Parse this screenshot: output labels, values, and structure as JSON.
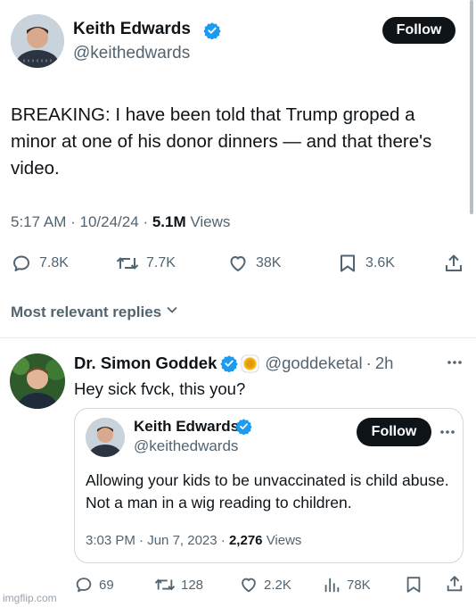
{
  "main_tweet": {
    "author_name": "Keith Edwards",
    "handle": "@keithedwards",
    "follow_label": "Follow",
    "text": "BREAKING: I have been told that Trump groped a minor at one of his donor dinners — and that there's video.",
    "time": "5:17 AM",
    "date": "10/24/24",
    "views_count": "5.1M",
    "views_label": "Views",
    "stats": {
      "replies": "7.8K",
      "reposts": "7.7K",
      "likes": "38K",
      "bookmarks": "3.6K"
    }
  },
  "replies_sort": {
    "label": "Most relevant replies"
  },
  "reply": {
    "author_name": "Dr. Simon Goddek",
    "handle": "@goddeketal",
    "age": "2h",
    "text": "Hey sick fvck, this you?",
    "stats": {
      "replies": "69",
      "reposts": "128",
      "likes": "2.2K",
      "views": "78K"
    }
  },
  "quoted_tweet": {
    "author_name": "Keith Edwards",
    "handle": "@keithedwards",
    "follow_label": "Follow",
    "text": "Allowing your kids to be unvaccinated is child abuse. Not a man in a wig reading to children.",
    "time": "3:03 PM",
    "date": "Jun 7, 2023",
    "views_count": "2,276",
    "views_label": "Views"
  },
  "watermark": "imgflip.com",
  "colors": {
    "verified_blue": "#1d9bf0",
    "text_primary": "#0f1419",
    "text_secondary": "#536471",
    "button_dark": "#0f1419",
    "divider": "#e6ecf0"
  },
  "icons": [
    "verified-badge-icon",
    "reply-icon",
    "repost-icon",
    "like-icon",
    "bookmark-icon",
    "share-icon",
    "views-icon",
    "chevron-down-icon",
    "more-icon",
    "gold-affiliate-badge-icon"
  ]
}
